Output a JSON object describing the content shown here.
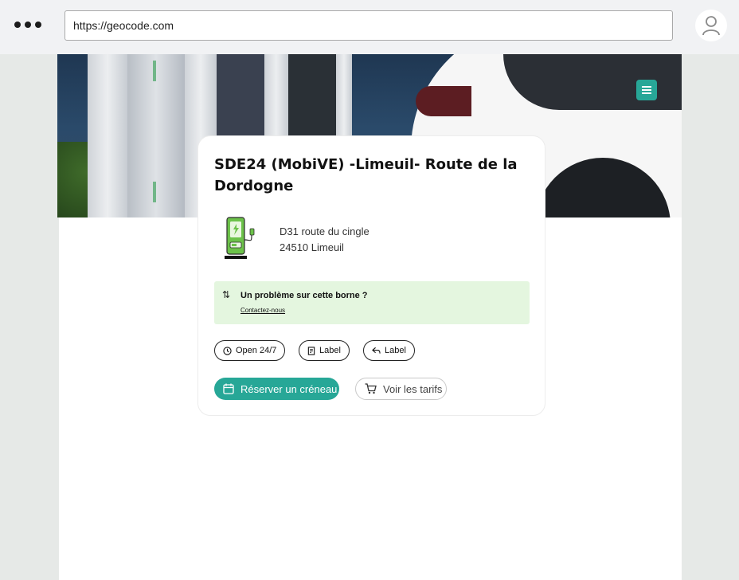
{
  "browser": {
    "url": "https://geocode.com"
  },
  "station": {
    "title": "SDE24 (MobiVE) -Limeuil- Route de la Dordogne",
    "address_line1": "D31 route du cingle",
    "address_line2": "24510 Limeuil"
  },
  "alert": {
    "text": "Un problème sur cette borne ?",
    "link": "Contactez-nous"
  },
  "chips": [
    {
      "label": "Open 24/7",
      "icon": "clock-icon"
    },
    {
      "label": "Label",
      "icon": "document-icon"
    },
    {
      "label": "Label",
      "icon": "reply-icon"
    }
  ],
  "actions": {
    "book_label": "Réserver un créneau",
    "pricing_label": "Voir les tarifs"
  },
  "colors": {
    "accent": "#27a797",
    "station_green": "#6cc24a",
    "alert_bg": "#e4f6df"
  }
}
